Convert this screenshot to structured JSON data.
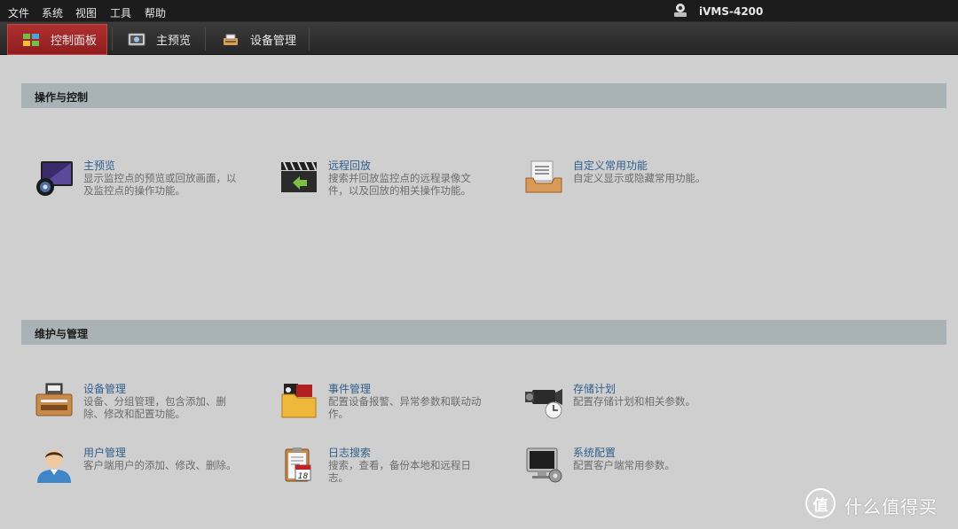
{
  "menu": {
    "items": [
      "文件",
      "系统",
      "视图",
      "工具",
      "帮助"
    ],
    "app_title": "iVMS-4200"
  },
  "tabs": [
    {
      "label": "控制面板",
      "icon": "grid-icon",
      "active": true
    },
    {
      "label": "主预览",
      "icon": "camera-preview-icon",
      "active": false
    },
    {
      "label": "设备管理",
      "icon": "device-icon",
      "active": false
    }
  ],
  "sections": [
    {
      "title": "操作与控制",
      "cards": [
        {
          "title": "主预览",
          "desc": "显示监控点的预览或回放画面，以及监控点的操作功能。",
          "icon": "monitor-camera-icon"
        },
        {
          "title": "远程回放",
          "desc": "搜索并回放监控点的远程录像文件，以及回放的相关操作功能。",
          "icon": "clapper-playback-icon"
        },
        {
          "title": "自定义常用功能",
          "desc": "自定义显示或隐藏常用功能。",
          "icon": "inbox-tray-icon"
        }
      ]
    },
    {
      "title": "维护与管理",
      "cards": [
        {
          "title": "设备管理",
          "desc": "设备、分组管理，包含添加、删除、修改和配置功能。",
          "icon": "device-box-icon"
        },
        {
          "title": "事件管理",
          "desc": "配置设备报警、异常参数和联动动作。",
          "icon": "event-folder-icon"
        },
        {
          "title": "存储计划",
          "desc": "配置存储计划和相关参数。",
          "icon": "video-camera-clock-icon"
        },
        {
          "title": "用户管理",
          "desc": "客户端用户的添加、修改、删除。",
          "icon": "user-icon"
        },
        {
          "title": "日志搜索",
          "desc": "搜索，查看，备份本地和远程日志。",
          "icon": "calendar-log-icon"
        },
        {
          "title": "系统配置",
          "desc": "配置客户端常用参数。",
          "icon": "monitor-gear-icon"
        }
      ]
    }
  ],
  "watermark": {
    "symbol": "值",
    "text": "什么值得买"
  },
  "colors": {
    "menubar": "#1c1c1c",
    "active_tab": "#9c2424",
    "section_header": "#a9b3b5",
    "card_title": "#2f5f8c",
    "content_bg": "#cfcfcf"
  }
}
